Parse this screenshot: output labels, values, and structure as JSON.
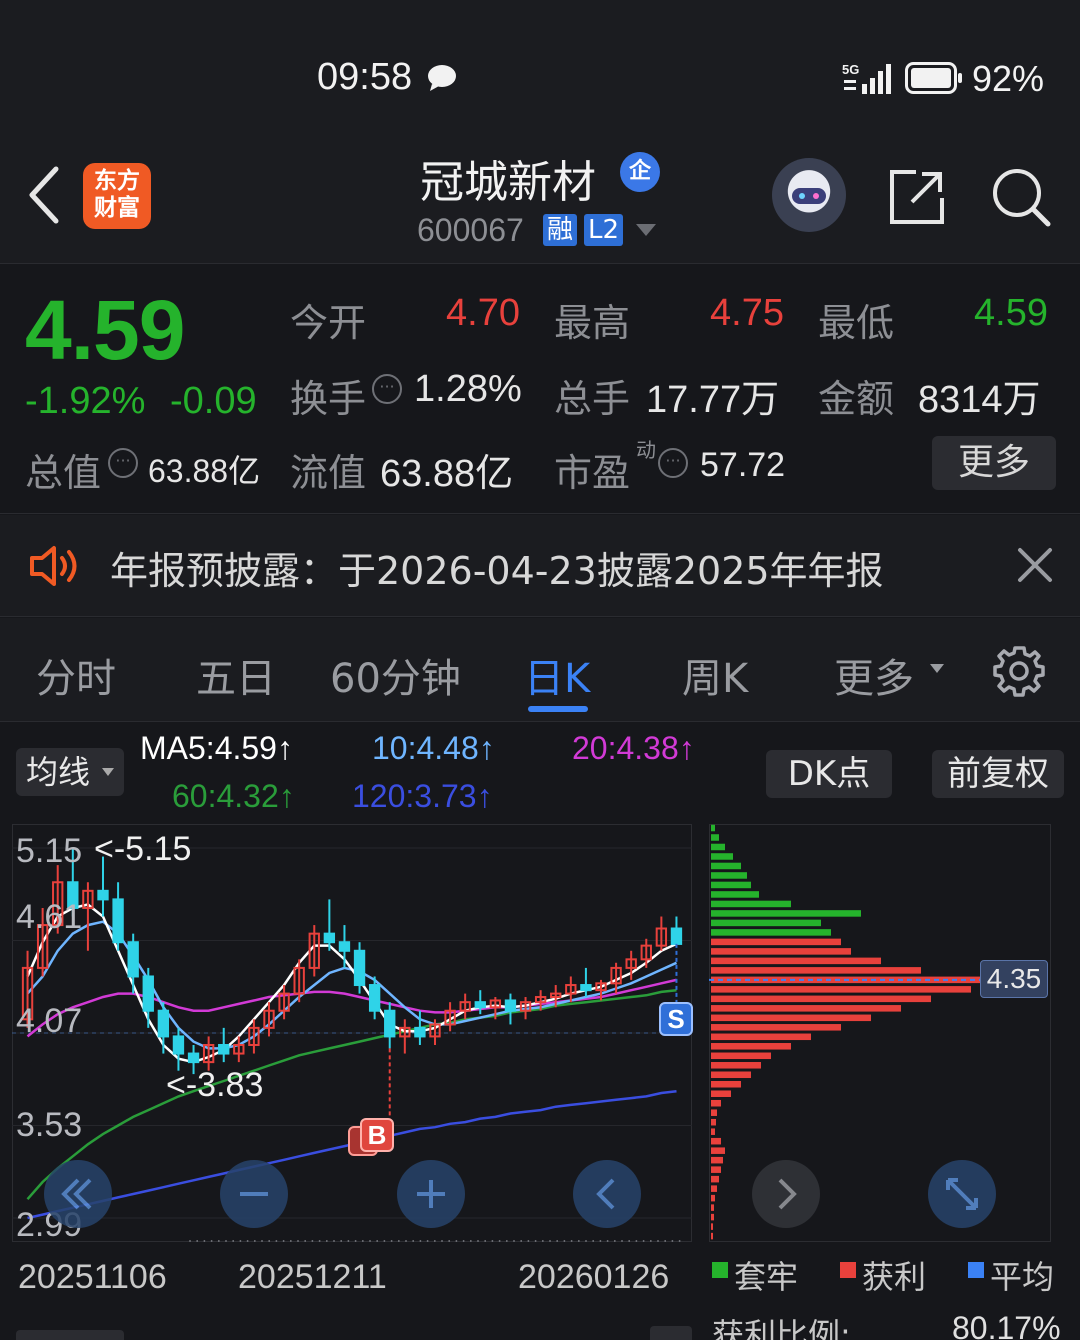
{
  "status_bar": {
    "time": "09:58",
    "network": "5G",
    "battery": "92%"
  },
  "header": {
    "logo_line1": "东方",
    "logo_line2": "财富",
    "stock_name": "冠城新材",
    "name_badge": "企",
    "stock_code": "600067",
    "badge_margin": "融",
    "badge_level": "L2"
  },
  "quote": {
    "price": "4.59",
    "change_pct": "-1.92%",
    "change_abs": "-0.09",
    "open_label": "今开",
    "open_value": "4.70",
    "high_label": "最高",
    "high_value": "4.75",
    "low_label": "最低",
    "low_value": "4.59",
    "turnover_label": "换手",
    "turnover_value": "1.28%",
    "volume_label": "总手",
    "volume_value": "17.77万",
    "amount_label": "金额",
    "amount_value": "8314万",
    "mktcap_label": "总值",
    "mktcap_value": "63.88亿",
    "float_label": "流值",
    "float_value": "63.88亿",
    "pe_label": "市盈",
    "pe_sup": "动",
    "pe_value": "57.72",
    "more_button": "更多"
  },
  "notice": {
    "text": "年报预披露：于2026-04-23披露2025年年报"
  },
  "tabs": [
    {
      "label": "分时"
    },
    {
      "label": "五日"
    },
    {
      "label": "60分钟"
    },
    {
      "label": "日K"
    },
    {
      "label": "周K"
    },
    {
      "label": "更多"
    }
  ],
  "indicators": {
    "selector": "均线",
    "ma5": "MA5:4.59↑",
    "ma10": "10:4.48↑",
    "ma20": "20:4.38↑",
    "ma60": "60:4.32↑",
    "ma120": "120:3.73↑",
    "dk_button": "DK点",
    "adjust_button": "前复权"
  },
  "colors": {
    "up": "#e8413c",
    "down": "#25b32c",
    "ma5": "#ffffff",
    "ma10": "#6fb5ff",
    "ma20": "#d23ad6",
    "ma60": "#2a9d3a",
    "ma120": "#3a4ee0",
    "accent": "#3b82f6"
  },
  "chart_data": [
    {
      "type": "candlestick",
      "y_tick_labels": [
        "5.15",
        "4.61",
        "4.07",
        "3.53",
        "2.99"
      ],
      "ylim": [
        2.99,
        5.15
      ],
      "x_tick_labels": [
        "20251106",
        "20251211",
        "20260126"
      ],
      "annotations": {
        "high_label": "<-5.15",
        "low_label": "<-3.83"
      },
      "markers": {
        "buy": "B",
        "sell": "S"
      },
      "candles": [
        [
          4.15,
          4.55,
          4.45,
          4.1
        ],
        [
          4.45,
          4.8,
          4.7,
          4.4
        ],
        [
          4.7,
          5.05,
          4.95,
          4.65
        ],
        [
          4.95,
          5.15,
          4.8,
          4.75
        ],
        [
          4.8,
          4.95,
          4.9,
          4.55
        ],
        [
          4.9,
          5.1,
          4.85,
          4.75
        ],
        [
          4.85,
          4.95,
          4.6,
          4.55
        ],
        [
          4.6,
          4.65,
          4.4,
          4.3
        ],
        [
          4.4,
          4.45,
          4.2,
          4.1
        ],
        [
          4.2,
          4.25,
          4.05,
          3.95
        ],
        [
          4.05,
          4.1,
          3.95,
          3.85
        ],
        [
          3.95,
          4.0,
          3.9,
          3.83
        ],
        [
          3.9,
          4.05,
          4.0,
          3.85
        ],
        [
          4.0,
          4.1,
          3.95,
          3.9
        ],
        [
          3.95,
          4.05,
          4.0,
          3.9
        ],
        [
          4.0,
          4.15,
          4.1,
          3.95
        ],
        [
          4.1,
          4.25,
          4.2,
          4.05
        ],
        [
          4.2,
          4.35,
          4.3,
          4.15
        ],
        [
          4.3,
          4.5,
          4.45,
          4.25
        ],
        [
          4.45,
          4.7,
          4.65,
          4.4
        ],
        [
          4.65,
          4.85,
          4.6,
          4.55
        ],
        [
          4.6,
          4.7,
          4.55,
          4.45
        ],
        [
          4.55,
          4.6,
          4.35,
          4.3
        ],
        [
          4.35,
          4.4,
          4.2,
          4.15
        ],
        [
          4.2,
          4.25,
          4.05,
          3.98
        ],
        [
          4.05,
          4.15,
          4.1,
          3.95
        ],
        [
          4.1,
          4.2,
          4.05,
          4.0
        ],
        [
          4.05,
          4.15,
          4.12,
          4.0
        ],
        [
          4.12,
          4.25,
          4.2,
          4.08
        ],
        [
          4.2,
          4.3,
          4.25,
          4.15
        ],
        [
          4.25,
          4.32,
          4.22,
          4.18
        ],
        [
          4.22,
          4.28,
          4.26,
          4.15
        ],
        [
          4.26,
          4.3,
          4.2,
          4.12
        ],
        [
          4.2,
          4.28,
          4.25,
          4.15
        ],
        [
          4.25,
          4.32,
          4.28,
          4.2
        ],
        [
          4.28,
          4.35,
          4.3,
          4.22
        ],
        [
          4.3,
          4.4,
          4.35,
          4.25
        ],
        [
          4.35,
          4.45,
          4.32,
          4.28
        ],
        [
          4.32,
          4.38,
          4.36,
          4.26
        ],
        [
          4.36,
          4.48,
          4.45,
          4.3
        ],
        [
          4.45,
          4.55,
          4.5,
          4.38
        ],
        [
          4.5,
          4.62,
          4.58,
          4.45
        ],
        [
          4.58,
          4.75,
          4.68,
          4.55
        ],
        [
          4.68,
          4.75,
          4.59,
          4.59
        ]
      ],
      "ma_series": {
        "ma5": [
          4.4,
          4.6,
          4.75,
          4.8,
          4.82,
          4.75,
          4.55,
          4.35,
          4.15,
          4.0,
          3.92,
          3.9,
          3.93,
          3.97,
          4.05,
          4.15,
          4.25,
          4.35,
          4.48,
          4.58,
          4.58,
          4.5,
          4.38,
          4.25,
          4.12,
          4.08,
          4.08,
          4.1,
          4.15,
          4.2,
          4.22,
          4.23,
          4.22,
          4.23,
          4.25,
          4.27,
          4.3,
          4.32,
          4.34,
          4.38,
          4.42,
          4.48,
          4.55,
          4.59
        ],
        "ma10": [
          4.3,
          4.4,
          4.55,
          4.65,
          4.7,
          4.72,
          4.65,
          4.52,
          4.38,
          4.22,
          4.1,
          4.02,
          3.98,
          3.98,
          4.0,
          4.05,
          4.12,
          4.2,
          4.28,
          4.35,
          4.42,
          4.45,
          4.43,
          4.38,
          4.3,
          4.22,
          4.15,
          4.12,
          4.12,
          4.14,
          4.16,
          4.18,
          4.2,
          4.21,
          4.22,
          4.24,
          4.26,
          4.28,
          4.3,
          4.33,
          4.36,
          4.4,
          4.44,
          4.48
        ],
        "ma20": [
          4.05,
          4.12,
          4.18,
          4.22,
          4.25,
          4.28,
          4.3,
          4.3,
          4.28,
          4.25,
          4.22,
          4.2,
          4.2,
          4.22,
          4.24,
          4.26,
          4.28,
          4.29,
          4.3,
          4.31,
          4.31,
          4.3,
          4.28,
          4.26,
          4.24,
          4.22,
          4.2,
          4.19,
          4.19,
          4.2,
          4.21,
          4.22,
          4.22,
          4.23,
          4.24,
          4.25,
          4.26,
          4.27,
          4.28,
          4.3,
          4.32,
          4.34,
          4.36,
          4.38
        ],
        "ma60": [
          3.1,
          3.2,
          3.28,
          3.35,
          3.42,
          3.48,
          3.53,
          3.58,
          3.62,
          3.66,
          3.7,
          3.73,
          3.76,
          3.79,
          3.82,
          3.85,
          3.88,
          3.91,
          3.94,
          3.96,
          3.98,
          4.0,
          4.02,
          4.04,
          4.06,
          4.08,
          4.1,
          4.12,
          4.13,
          4.15,
          4.16,
          4.17,
          4.19,
          4.2,
          4.21,
          4.23,
          4.24,
          4.25,
          4.26,
          4.27,
          4.28,
          4.29,
          4.31,
          4.32
        ],
        "ma120": [
          2.99,
          3.01,
          3.03,
          3.05,
          3.07,
          3.09,
          3.11,
          3.13,
          3.15,
          3.17,
          3.19,
          3.21,
          3.23,
          3.25,
          3.27,
          3.29,
          3.31,
          3.33,
          3.35,
          3.37,
          3.39,
          3.41,
          3.43,
          3.45,
          3.47,
          3.49,
          3.51,
          3.52,
          3.54,
          3.55,
          3.57,
          3.58,
          3.6,
          3.61,
          3.62,
          3.64,
          3.65,
          3.66,
          3.67,
          3.68,
          3.69,
          3.7,
          3.72,
          3.73
        ]
      }
    },
    {
      "type": "bar",
      "orientation": "horizontal",
      "current_price_label": "4.35",
      "legend": [
        {
          "name": "套牢",
          "color": "#25b32c"
        },
        {
          "name": "获利",
          "color": "#e8413c"
        },
        {
          "name": "平均",
          "color": "#3b82f6"
        }
      ],
      "profit_ratio_label": "获利比例:",
      "profit_ratio_value": "80.17%",
      "price_levels": [
        5.15,
        5.1,
        5.05,
        5.0,
        4.95,
        4.9,
        4.85,
        4.8,
        4.75,
        4.7,
        4.65,
        4.6,
        4.55,
        4.5,
        4.45,
        4.4,
        4.35,
        4.3,
        4.25,
        4.2,
        4.15,
        4.1,
        4.05,
        4.0,
        3.95,
        3.9,
        3.85,
        3.8,
        3.75,
        3.7,
        3.65,
        3.6,
        3.55,
        3.5,
        3.45,
        3.4,
        3.35,
        3.3,
        3.25,
        3.2,
        3.15,
        3.1,
        3.05,
        3.0
      ],
      "weights": [
        4,
        8,
        14,
        22,
        30,
        36,
        40,
        48,
        80,
        150,
        110,
        120,
        130,
        140,
        170,
        210,
        270,
        260,
        220,
        190,
        160,
        130,
        100,
        80,
        60,
        50,
        40,
        30,
        20,
        10,
        6,
        5,
        4,
        10,
        14,
        12,
        10,
        8,
        6,
        4,
        3,
        3,
        2,
        2
      ],
      "holding_split_price": 4.59
    }
  ],
  "chart_controls": {
    "rewind": "«",
    "zoom_out": "−",
    "zoom_in": "+",
    "prev": "‹",
    "next": "›",
    "expand": "⤡"
  }
}
